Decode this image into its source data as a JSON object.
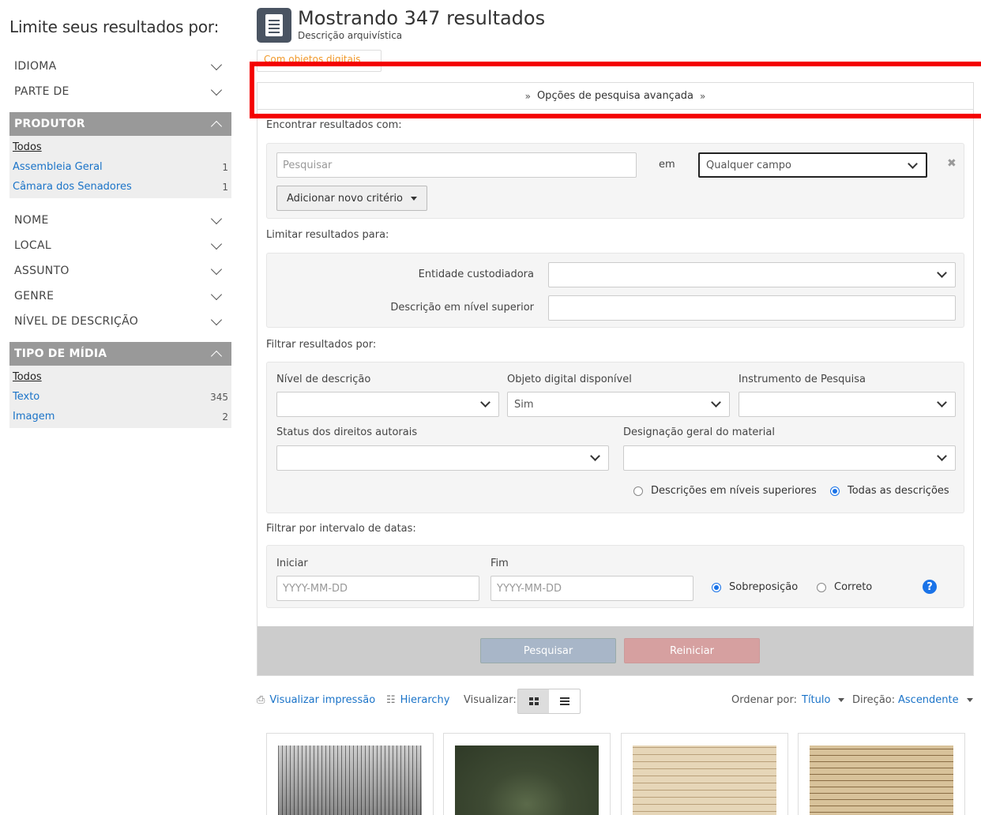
{
  "sidebar": {
    "title": "Limite seus resultados por:",
    "facets_top": [
      {
        "label": "IDIOMA"
      },
      {
        "label": "PARTE DE"
      }
    ],
    "produtor": {
      "label": "PRODUTOR",
      "items": [
        {
          "label": "Todos",
          "count": ""
        },
        {
          "label": "Assembleia Geral",
          "count": "1"
        },
        {
          "label": "Câmara dos Senadores",
          "count": "1"
        }
      ]
    },
    "facets_mid": [
      {
        "label": "NOME"
      },
      {
        "label": "LOCAL"
      },
      {
        "label": "ASSUNTO"
      },
      {
        "label": "GENRE"
      },
      {
        "label": "NÍVEL DE DESCRIÇÃO"
      }
    ],
    "tipo_midia": {
      "label": "TIPO DE MÍDIA",
      "items": [
        {
          "label": "Todos",
          "count": ""
        },
        {
          "label": "Texto",
          "count": "345"
        },
        {
          "label": "Imagem",
          "count": "2"
        }
      ]
    }
  },
  "header": {
    "title": "Mostrando 347 resultados",
    "subtitle": "Descrição arquivística",
    "filter_tag": "Com objetos digitais"
  },
  "advanced": {
    "toggle_label": "Opções de pesquisa avançada",
    "find_label": "Encontrar resultados com:",
    "search_placeholder": "Pesquisar",
    "in_label": "em",
    "field_select": "Qualquer campo",
    "add_criteria": "Adicionar novo critério",
    "limit_label": "Limitar resultados para:",
    "repository_label": "Entidade custodiadora",
    "repository_value": "",
    "parent_label": "Descrição em nível superior",
    "parent_value": "",
    "filter_label": "Filtrar resultados por:",
    "level_label": "Nível de descrição",
    "level_value": "",
    "digital_label": "Objeto digital disponível",
    "digital_value": "Sim",
    "finding_label": "Instrumento de Pesquisa",
    "finding_value": "",
    "copyright_label": "Status dos direitos autorais",
    "copyright_value": "",
    "material_label": "Designação geral do material",
    "material_value": "",
    "radio_top": "Descrições em níveis superiores",
    "radio_all": "Todas as descrições",
    "date_label": "Filtrar por intervalo de datas:",
    "start_label": "Iniciar",
    "end_label": "Fim",
    "date_placeholder": "YYYY-MM-DD",
    "radio_overlap": "Sobreposição",
    "radio_exact": "Correto",
    "search_button": "Pesquisar",
    "reset_button": "Reiniciar"
  },
  "toolbar": {
    "print": "Visualizar impressão",
    "hierarchy": "Hierarchy",
    "view_label": "Visualizar:",
    "sort_label": "Ordenar por:",
    "sort_value": "Título",
    "direction_label": "Direção:",
    "direction_value": "Ascendente"
  }
}
